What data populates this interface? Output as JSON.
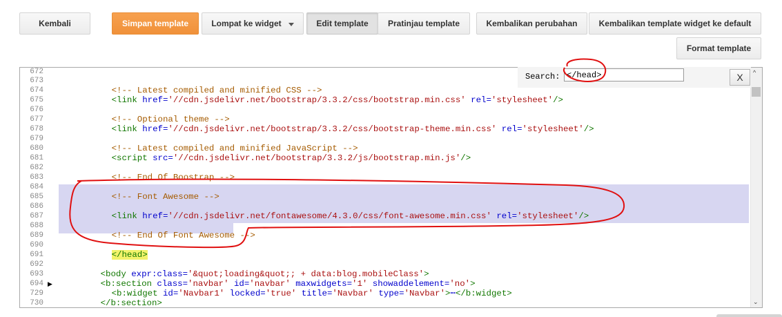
{
  "toolbar": {
    "back": "Kembali",
    "save": "Simpan template",
    "jump": "Lompat ke widget",
    "edit": "Edit template",
    "preview": "Pratinjau template",
    "revert": "Kembalikan perubahan",
    "revert_widgets": "Kembalikan template widget ke default",
    "format": "Format template"
  },
  "search": {
    "label": "Search:",
    "value": "</head>",
    "close": "X"
  },
  "lines": {
    "n672": "672",
    "n673": "673",
    "n674": "674",
    "n675": "675",
    "n676": "676",
    "n677": "677",
    "n678": "678",
    "n679": "679",
    "n680": "680",
    "n681": "681",
    "n682": "682",
    "n683": "683",
    "n684": "684",
    "n685": "685",
    "n686": "686",
    "n687": "687",
    "n688": "688",
    "n689": "689",
    "n690": "690",
    "n691": "691",
    "n692": "692",
    "n693": "693",
    "n694": "694",
    "n729": "729",
    "n730": "730"
  },
  "code": {
    "l673": "<!-- Latest compiled and minified CSS -->",
    "l674": {
      "open": "<link",
      "a1": " href=",
      "v1": "'//cdn.jsdelivr.net/bootstrap/3.3.2/css/bootstrap.min.css'",
      "a2": " rel=",
      "v2": "'stylesheet'",
      "close": "/>"
    },
    "l676": "<!-- Optional theme -->",
    "l677": {
      "open": "<link",
      "a1": " href=",
      "v1": "'//cdn.jsdelivr.net/bootstrap/3.3.2/css/bootstrap-theme.min.css'",
      "a2": " rel=",
      "v2": "'stylesheet'",
      "close": "/>"
    },
    "l679": "<!-- Latest compiled and minified JavaScript -->",
    "l680": {
      "open": "<script",
      "a1": " src=",
      "v1": "'//cdn.jsdelivr.net/bootstrap/3.3.2/js/bootstrap.min.js'",
      "close": "/>"
    },
    "l682": "<!-- End Of Boostrap -->",
    "l684": "<!-- Font Awesome -->",
    "l686": {
      "open": "<link",
      "a1": " href=",
      "v1": "'//cdn.jsdelivr.net/fontawesome/4.3.0/css/font-awesome.min.css'",
      "a2": " rel=",
      "v2": "'stylesheet'",
      "close": "/>"
    },
    "l688": "<!-- End Of Font Awesome -->",
    "l690": "</head>",
    "l692": {
      "open": "<body",
      "a1": " expr:class=",
      "v1a": "'",
      "e1": "&quot;",
      "v1b": "loading",
      "e2": "&quot;",
      "v1c": "; + data:blog.mobileClass'",
      "close": ">"
    },
    "l693": {
      "open": "<b:section",
      "a1": " class=",
      "v1": "'navbar'",
      "a2": " id=",
      "v2": "'navbar'",
      "a3": " maxwidgets=",
      "v3": "'1'",
      "a4": " showaddelement=",
      "v4": "'no'",
      "close": ">"
    },
    "l694": {
      "open": "<b:widget",
      "a1": " id=",
      "v1": "'Navbar1'",
      "a2": " locked=",
      "v2": "'true'",
      "a3": " title=",
      "v3": "'Navbar'",
      "a4": " type=",
      "v4": "'Navbar'",
      "close": ">",
      "dots": "⋯",
      "end": "</b:widget>"
    },
    "l729": "</b:section>"
  },
  "icons": {
    "fold": "fold-arrow-icon",
    "scroll_up": "scroll-up-icon",
    "scroll_down": "scroll-down-icon"
  }
}
